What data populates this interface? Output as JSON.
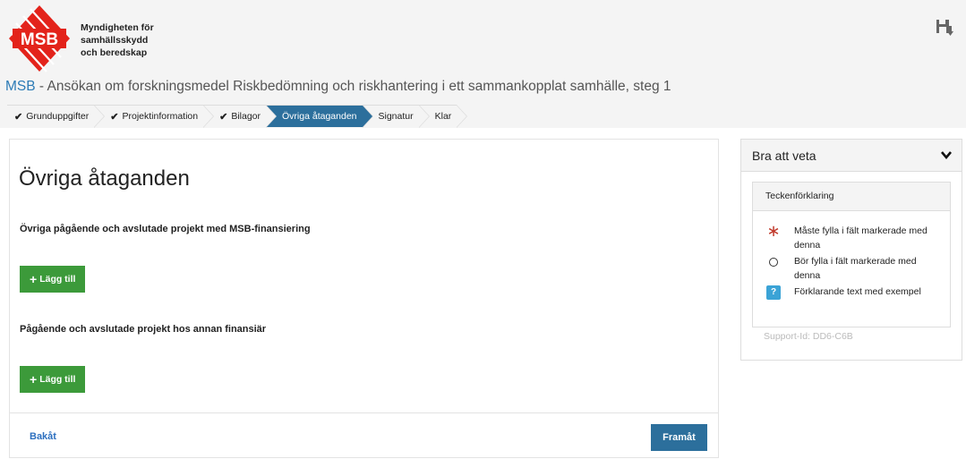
{
  "org": {
    "logo_text": "MSB",
    "name_lines": [
      "Myndigheten för",
      "samhällsskydd",
      "och beredskap"
    ],
    "brand_color": "#e3231b"
  },
  "header": {
    "title_brand": "MSB",
    "title_rest": " - Ansökan om forskningsmedel Riskbedömning och riskhantering i ett sammankopplat samhälle, steg 1",
    "save_icon": "save-download-icon"
  },
  "steps": [
    {
      "label": "Grunduppgifter",
      "done": true,
      "active": false
    },
    {
      "label": "Projektinformation",
      "done": true,
      "active": false
    },
    {
      "label": "Bilagor",
      "done": true,
      "active": false
    },
    {
      "label": "Övriga åtaganden",
      "done": false,
      "active": true
    },
    {
      "label": "Signatur",
      "done": false,
      "active": false
    },
    {
      "label": "Klar",
      "done": false,
      "active": false
    }
  ],
  "main": {
    "title": "Övriga åtaganden",
    "section1_label": "Övriga pågående och avslutade projekt med MSB-finansiering",
    "section2_label": "Pågående och avslutade projekt hos annan finansiär",
    "add_label": "Lägg till",
    "back_label": "Bakåt",
    "next_label": "Framåt"
  },
  "sidebar": {
    "title": "Bra att veta",
    "legend_title": "Teckenförklaring",
    "legend": [
      {
        "icon": "required-asterisk-icon",
        "text": "Måste fylla i fält markerade med denna"
      },
      {
        "icon": "recommended-circle-icon",
        "text": "Bör fylla i fält markerade med denna"
      },
      {
        "icon": "help-question-icon",
        "text": "Förklarande text med exempel"
      }
    ],
    "support_id": "Support-Id: DD6-C6B"
  },
  "colors": {
    "primary": "#2c6f9c",
    "success": "#3c9a3a",
    "required": "#c0392b",
    "help": "#3ba3d6"
  }
}
